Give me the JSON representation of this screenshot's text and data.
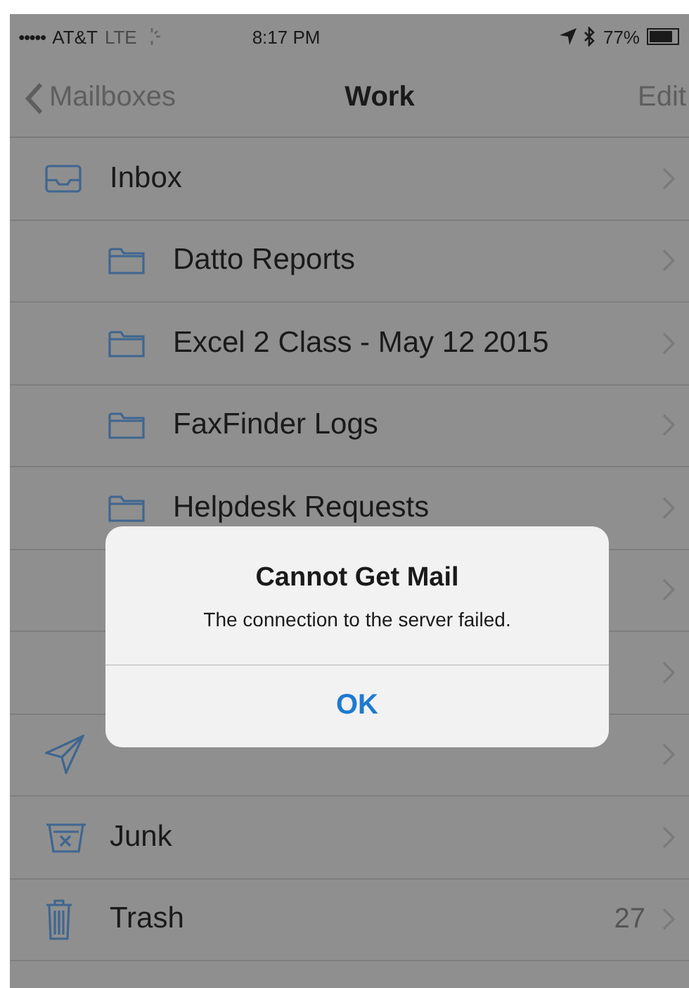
{
  "status_bar": {
    "signal": "●●●●●",
    "carrier": "AT&T",
    "network": "LTE",
    "time": "8:17 PM",
    "battery": "77%"
  },
  "nav_bar": {
    "back": "Mailboxes",
    "title": "Work",
    "action": "Edit"
  },
  "mailboxes": [
    {
      "kind": "inbox",
      "label": "Inbox",
      "children": [
        {
          "kind": "folder",
          "label": "Datto Reports"
        },
        {
          "kind": "folder",
          "label": "Excel 2 Class - May 12 2015"
        },
        {
          "kind": "folder",
          "label": "FaxFinder Logs"
        },
        {
          "kind": "folder",
          "label": "Helpdesk Requests"
        },
        {
          "kind": "covered"
        },
        {
          "kind": "covered"
        }
      ]
    },
    {
      "kind": "sent"
    },
    {
      "kind": "junk",
      "label": "Junk"
    },
    {
      "kind": "trash",
      "label": "Trash",
      "count": "27"
    }
  ],
  "alert": {
    "title": "Cannot Get Mail",
    "message": "The connection to the server failed.",
    "button": "OK"
  }
}
